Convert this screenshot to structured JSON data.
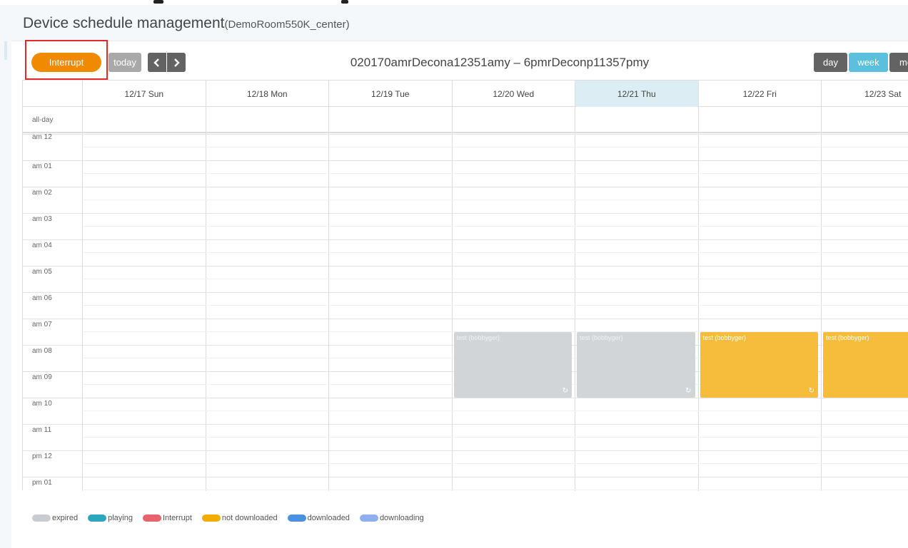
{
  "page": {
    "title": "Device schedule management",
    "subtitle": "(DemoRoom550K_center)"
  },
  "toolbar": {
    "interrupt_label": "Interrupt",
    "today_label": "today",
    "prev_icon": "chevron-left-icon",
    "next_icon": "chevron-right-icon",
    "range_title": "020170amrDecona12351amy – 6pmrDeconp11357pmy",
    "views": [
      {
        "label": "day"
      },
      {
        "label": "week",
        "active": true
      },
      {
        "label": "mo"
      }
    ]
  },
  "calendar": {
    "days": [
      {
        "label": "12/17 Sun"
      },
      {
        "label": "12/18 Mon"
      },
      {
        "label": "12/19 Tue"
      },
      {
        "label": "12/20 Wed"
      },
      {
        "label": "12/21 Thu",
        "today": true
      },
      {
        "label": "12/22 Fri"
      },
      {
        "label": "12/23 Sat"
      }
    ],
    "allday_label": "all-day",
    "times": [
      "am 12",
      "am 01",
      "am 02",
      "am 03",
      "am 04",
      "am 05",
      "am 06",
      "am 07",
      "am 08",
      "am 09",
      "am 10",
      "am 11",
      "pm 12",
      "pm 01"
    ],
    "events": [
      {
        "day": 3,
        "title": "test (bobbyger)",
        "status": "expired"
      },
      {
        "day": 4,
        "title": "test (bobbyger)",
        "status": "expired"
      },
      {
        "day": 5,
        "title": "test (bobbyger)",
        "status": "not downloaded"
      },
      {
        "day": 6,
        "title": "test (bobbyger)",
        "status": "not downloaded"
      }
    ]
  },
  "legend": [
    {
      "label": "expired",
      "color": "#c9cdd1"
    },
    {
      "label": "playing",
      "color": "#2aa7bd"
    },
    {
      "label": "Interrupt",
      "color": "#e8636b"
    },
    {
      "label": "not downloaded",
      "color": "#f0ad00"
    },
    {
      "label": "downloaded",
      "color": "#4a90e2"
    },
    {
      "label": "downloading",
      "color": "#8fb0ee"
    }
  ],
  "colors": {
    "interrupt_button": "#f08a00",
    "active_view": "#5bc0de",
    "today_column": "#dceef4",
    "expired_event": "#d2d5d8",
    "not_downloaded_event": "#f5bd3b"
  }
}
